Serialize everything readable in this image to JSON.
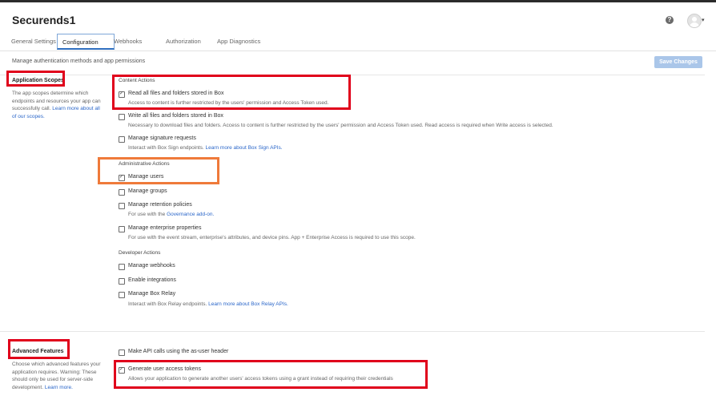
{
  "app": {
    "title": "Securends1",
    "help_glyph": "?",
    "avatar_caret": "▾"
  },
  "tabs": [
    {
      "label": "General Settings",
      "active": false
    },
    {
      "label": "Configuration",
      "active": true
    },
    {
      "label": "Webhooks",
      "active": false
    },
    {
      "label": "Authorization",
      "active": false
    },
    {
      "label": "App Diagnostics",
      "active": false
    }
  ],
  "header": {
    "subtitle": "Manage authentication methods and app permissions",
    "save_label": "Save Changes"
  },
  "scopes": {
    "title": "Application Scopes",
    "desc_line1": "The app scopes determine which",
    "desc_line2": "endpoints and resources your app can",
    "desc_line3_text": "successfully call. ",
    "desc_line3_link": "Learn more about all",
    "desc_line4_link": "of our scopes.",
    "content_actions": "Content Actions",
    "read_files": {
      "label": "Read all files and folders stored in Box",
      "desc": "Access to content is further restricted by the users' permission and Access Token used.",
      "checked": true
    },
    "write_files": {
      "label": "Write all files and folders stored in Box",
      "desc": "Necessary to download files and folders. Access to content is further restricted by the users' permission and Access Token used. Read access is required when Write access is selected.",
      "checked": false
    },
    "sign_requests": {
      "label": "Manage signature requests",
      "desc_text": "Interact with Box Sign endpoints. ",
      "desc_link": "Learn more about Box Sign APIs.",
      "checked": false
    },
    "admin_actions": "Administrative Actions",
    "manage_users": {
      "label": "Manage users",
      "checked": true
    },
    "manage_groups": {
      "label": "Manage groups",
      "checked": false
    },
    "retention": {
      "label": "Manage retention policies",
      "desc_text": "For use with the ",
      "desc_link": "Governance add-on.",
      "checked": false
    },
    "enterprise_props": {
      "label": "Manage enterprise properties",
      "desc": "For use with the event stream, enterprise's attributes, and device pins. App + Enterprise Access is required to use this scope.",
      "checked": false
    },
    "developer_actions": "Developer Actions",
    "webhooks": {
      "label": "Manage webhooks",
      "checked": false
    },
    "integrations": {
      "label": "Enable integrations",
      "checked": false
    },
    "box_relay": {
      "label": "Manage Box Relay",
      "desc_text": "Interact with Box Relay endpoints. ",
      "desc_link": "Learn more about Box Relay APIs.",
      "checked": false
    }
  },
  "advanced": {
    "title": "Advanced Features",
    "desc_line1": "Choose which advanced features your",
    "desc_line2": "application requires. Warning: These",
    "desc_line3": "should only be used for server-side",
    "desc_line4_text": "development. ",
    "desc_line4_link": "Learn more.",
    "as_user": {
      "label": "Make API calls using the as-user header",
      "checked": false
    },
    "gen_tokens": {
      "label": "Generate user access tokens",
      "desc": "Allows your application to generate another users' access tokens using a grant instead of requiring their credentials",
      "checked": true
    }
  },
  "colors": {
    "highlight_red": "#e0001b",
    "highlight_orange": "#ef7a3a",
    "link": "#2a66c9",
    "save_button": "#aac6e9",
    "tab_active": "#2f6fbf"
  }
}
